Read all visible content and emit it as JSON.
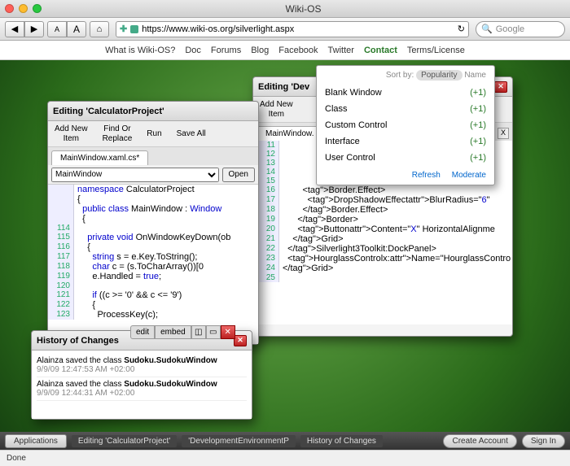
{
  "browser": {
    "title": "Wiki-OS",
    "url": "https://www.wiki-os.org/silverlight.aspx",
    "search_placeholder": "Google",
    "back": "◀",
    "fwd": "▶",
    "font_a": "A",
    "home": "⌂",
    "reload": "↻",
    "search_icon": "🔍"
  },
  "nav": [
    "What is Wiki-OS?",
    "Doc",
    "Forums",
    "Blog",
    "Facebook",
    "Twitter",
    "Contact",
    "Terms/License"
  ],
  "nav_active_index": 6,
  "win_calc": {
    "title": "Editing 'CalculatorProject'",
    "menu": [
      "Add New\nItem",
      "Find Or\nReplace",
      "Run",
      "Save All"
    ],
    "tab": "MainWindow.xaml.cs*",
    "combo": "MainWindow",
    "open": "Open",
    "lines": [
      {
        "n": "",
        "t": "namespace CalculatorProject"
      },
      {
        "n": "",
        "t": "{"
      },
      {
        "n": "",
        "t": "  public class MainWindow : Window"
      },
      {
        "n": "",
        "t": "  {"
      },
      {
        "n": "114",
        "t": ""
      },
      {
        "n": "115",
        "t": "    private void OnWindowKeyDown(ob"
      },
      {
        "n": "116",
        "t": "    {"
      },
      {
        "n": "117",
        "t": "      string s = e.Key.ToString();"
      },
      {
        "n": "118",
        "t": "      char c = (s.ToCharArray())[0"
      },
      {
        "n": "119",
        "t": "      e.Handled = true;"
      },
      {
        "n": "120",
        "t": ""
      },
      {
        "n": "121",
        "t": "      if ((c >= '0' && c <= '9') "
      },
      {
        "n": "122",
        "t": "      {"
      },
      {
        "n": "123",
        "t": "        ProcessKey(c);"
      }
    ]
  },
  "win_dev": {
    "title": "Editing 'Dev",
    "menu_item": "Add New\nItem",
    "tab": "MainWindow.",
    "close_x": "X",
    "lines": [
      {
        "n": "11",
        "t": ""
      },
      {
        "n": "12",
        "t": ""
      },
      {
        "n": "13",
        "t": ""
      },
      {
        "n": "14",
        "t": ""
      },
      {
        "n": "15",
        "t": ""
      },
      {
        "n": "16",
        "t": "        <Border.Effect>"
      },
      {
        "n": "17",
        "t": "          <DropShadowEffect BlurRadius=\"6\" "
      },
      {
        "n": "18",
        "t": "        </Border.Effect>"
      },
      {
        "n": "19",
        "t": "      </Border>"
      },
      {
        "n": "20",
        "t": "      <Button Content=\"X\" HorizontalAlignme"
      },
      {
        "n": "21",
        "t": "    </Grid>"
      },
      {
        "n": "22",
        "t": "  </Silverlight3Toolkit:DockPanel>"
      },
      {
        "n": "23",
        "t": "  <HourglassControl x:Name=\"HourglassContro"
      },
      {
        "n": "24",
        "t": "</Grid>"
      },
      {
        "n": "25",
        "t": ""
      }
    ]
  },
  "dropdown": {
    "sort_label": "Sort by:",
    "sort_pop": "Popularity",
    "sort_name": "Name",
    "items": [
      {
        "label": "Blank Window",
        "plus": "(+1)"
      },
      {
        "label": "Class",
        "plus": "(+1)"
      },
      {
        "label": "Custom Control",
        "plus": "(+1)"
      },
      {
        "label": "Interface",
        "plus": "(+1)"
      },
      {
        "label": "User Control",
        "plus": "(+1)"
      }
    ],
    "refresh": "Refresh",
    "moderate": "Moderate"
  },
  "history": {
    "title": "History of Changes",
    "pills": [
      "edit",
      "embed"
    ],
    "entries": [
      {
        "text": "Alainza saved the class Sudoku.SudokuWindow",
        "time": "9/9/09 12:47:53 AM +02:00"
      },
      {
        "text": "Alainza saved the class Sudoku.SudokuWindow",
        "time": "9/9/09 12:44:31 AM +02:00"
      }
    ]
  },
  "taskbar": {
    "start": "Applications",
    "tasks": [
      "Editing 'CalculatorProject'",
      "'DevelopmentEnvironmentP",
      "History of Changes"
    ],
    "create": "Create Account",
    "signin": "Sign In"
  },
  "status": "Done"
}
